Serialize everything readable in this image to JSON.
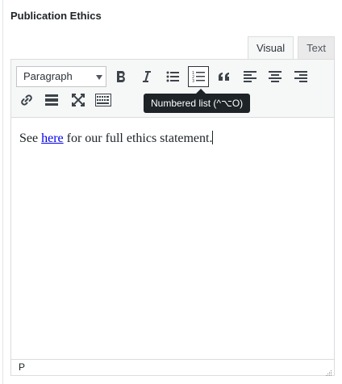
{
  "section": {
    "title": "Publication Ethics"
  },
  "tabs": [
    {
      "label": "Visual",
      "active": true
    },
    {
      "label": "Text",
      "active": false
    }
  ],
  "toolbar": {
    "format_select_value": "Paragraph",
    "buttons_row1": [
      "bold-icon",
      "italic-icon",
      "bulleted-list-icon",
      "numbered-list-icon",
      "blockquote-icon",
      "align-left-icon",
      "align-center-icon",
      "align-right-icon"
    ],
    "buttons_row2": [
      "link-icon",
      "horizontal-rule-icon",
      "fullscreen-icon",
      "keyboard-icon"
    ],
    "pressed_button": "numbered-list-icon",
    "tooltip": "Numbered list (^⌥O)"
  },
  "content": {
    "before_link": "See ",
    "link_text": "here",
    "after_link": " for our full ethics statement."
  },
  "statusbar": {
    "path": "P"
  },
  "colors": {
    "link": "#0000ee",
    "tooltip_bg": "#1d2327",
    "toolbar_bg": "#f6f7f7"
  }
}
